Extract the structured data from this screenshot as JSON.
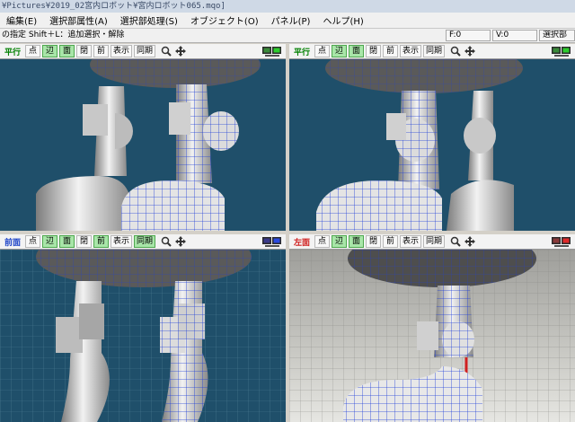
{
  "window": {
    "title": "¥Pictures¥2019_02宮内ロボット¥宮内ロボット065.mqo]"
  },
  "menu": [
    "編集(E)",
    "選択部属性(A)",
    "選択部処理(S)",
    "オブジェクト(O)",
    "パネル(P)",
    "ヘルプ(H)"
  ],
  "status": {
    "hint": "の指定 Shift＋L：追加選択・解除",
    "f": "F:0",
    "v": "V:0",
    "sel": "選択部"
  },
  "panes": [
    {
      "name": "top-left",
      "label": "平行",
      "label_color": "#008000",
      "buttons": [
        "点",
        "辺",
        "面",
        "閉",
        "前",
        "表示",
        "同期"
      ],
      "on": [
        1,
        2
      ]
    },
    {
      "name": "top-right",
      "label": "平行",
      "label_color": "#008000",
      "buttons": [
        "点",
        "辺",
        "面",
        "閉",
        "前",
        "表示",
        "同期"
      ],
      "on": [
        1,
        2
      ]
    },
    {
      "name": "bottom-left",
      "label": "前面",
      "label_color": "#1d43c8",
      "buttons": [
        "点",
        "辺",
        "面",
        "閉",
        "前",
        "表示",
        "同期"
      ],
      "on": [
        1,
        2,
        4,
        6
      ]
    },
    {
      "name": "bottom-right",
      "label": "左面",
      "label_color": "#d02020",
      "buttons": [
        "点",
        "辺",
        "面",
        "閉",
        "前",
        "表示",
        "同期"
      ],
      "on": [
        1,
        2
      ]
    }
  ],
  "icons": {
    "zoom": "magnifier-icon",
    "move": "move-arrows-icon",
    "monitor": "monitor-icon"
  },
  "colors": {
    "viewport_bg": "#1f4f6a",
    "mesh": "#2040d8",
    "toggle_on": "#a8e6a8"
  }
}
